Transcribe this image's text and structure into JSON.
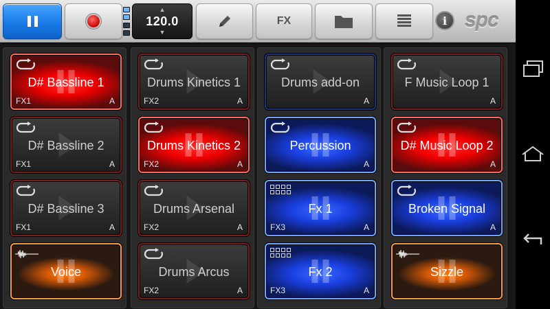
{
  "toolbar": {
    "tempo": "120.0",
    "fx_label": "FX",
    "logo": "spc",
    "info": "i",
    "accent": "#1979e6"
  },
  "icons": {
    "pause": "pause-icon",
    "record": "record-icon",
    "edit": "pencil-icon",
    "folder": "folder-icon",
    "list": "list-icon",
    "info": "info-icon",
    "loop": "loop-icon",
    "sequencer": "grid-icon",
    "sample": "waveform-icon"
  },
  "columns": [
    {
      "pads": [
        {
          "title": "D# Bassline 1",
          "fx": "FX1",
          "bank": "A",
          "icon": "loop",
          "state": "on-red"
        },
        {
          "title": "D# Bassline 2",
          "fx": "FX1",
          "bank": "A",
          "icon": "loop",
          "state": "b-red"
        },
        {
          "title": "D# Bassline 3",
          "fx": "FX1",
          "bank": "A",
          "icon": "loop",
          "state": "b-red"
        },
        {
          "title": "Voice",
          "fx": "",
          "bank": "",
          "icon": "wave",
          "state": "on-orange"
        }
      ]
    },
    {
      "pads": [
        {
          "title": "Drums Kinetics 1",
          "fx": "FX2",
          "bank": "A",
          "icon": "loop",
          "state": "b-red"
        },
        {
          "title": "Drums Kinetics 2",
          "fx": "FX2",
          "bank": "A",
          "icon": "loop",
          "state": "on-red"
        },
        {
          "title": "Drums Arsenal",
          "fx": "FX2",
          "bank": "A",
          "icon": "loop",
          "state": "b-red"
        },
        {
          "title": "Drums Arcus",
          "fx": "FX2",
          "bank": "A",
          "icon": "loop",
          "state": "b-red"
        }
      ]
    },
    {
      "pads": [
        {
          "title": "Drums add-on",
          "fx": "",
          "bank": "A",
          "icon": "loop",
          "state": "b-blue"
        },
        {
          "title": "Percussion",
          "fx": "",
          "bank": "A",
          "icon": "loop",
          "state": "on-blue"
        },
        {
          "title": "Fx 1",
          "fx": "FX3",
          "bank": "A",
          "icon": "grid",
          "state": "on-blue"
        },
        {
          "title": "Fx 2",
          "fx": "FX3",
          "bank": "A",
          "icon": "grid",
          "state": "on-blue"
        }
      ]
    },
    {
      "pads": [
        {
          "title": "F Music Loop 1",
          "fx": "",
          "bank": "A",
          "icon": "loop",
          "state": "b-red"
        },
        {
          "title": "D# Music Loop 2",
          "fx": "",
          "bank": "A",
          "icon": "loop",
          "state": "on-red"
        },
        {
          "title": "Broken Signal",
          "fx": "",
          "bank": "A",
          "icon": "loop",
          "state": "on-blue"
        },
        {
          "title": "Sizzle",
          "fx": "",
          "bank": "",
          "icon": "wave",
          "state": "on-orange"
        }
      ]
    }
  ],
  "navbar": {
    "recents": "recent-apps-icon",
    "home": "home-icon",
    "back": "back-icon"
  }
}
